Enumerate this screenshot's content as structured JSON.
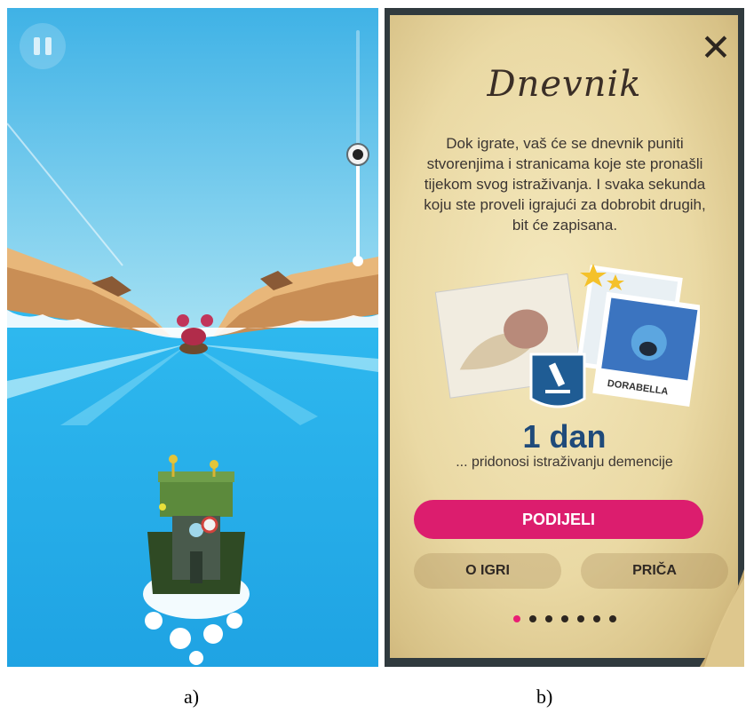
{
  "panel_a": {
    "caption": "a)",
    "progress_fraction": 0.5,
    "icons": {
      "pause": "pause-icon",
      "progress_knob": "eye-icon"
    }
  },
  "panel_b": {
    "caption": "b)",
    "title": "Dnevnik",
    "description": "Dok igrate, vaš će se dnevnik puniti stvorenjima i stranicama koje ste pronašli tijekom svog istraživanja. I svaka sekunda koju ste proveli igrajući za dobrobit drugih, bit će zapisana.",
    "card_label": "DORABELLA",
    "days_count": "1 dan",
    "days_subtitle": "... pridonosi istraživanju demencije",
    "share_button": "PODIJELI",
    "about_button": "O IGRI",
    "story_button": "PRIČA",
    "page_dots": {
      "total": 7,
      "active": 0
    },
    "icons": {
      "close": "close-icon",
      "microscope": "microscope-icon",
      "star": "star-icon"
    },
    "colors": {
      "accent": "#dc1d6e",
      "days": "#1f4a7a",
      "paper": "#ead9a4"
    }
  }
}
